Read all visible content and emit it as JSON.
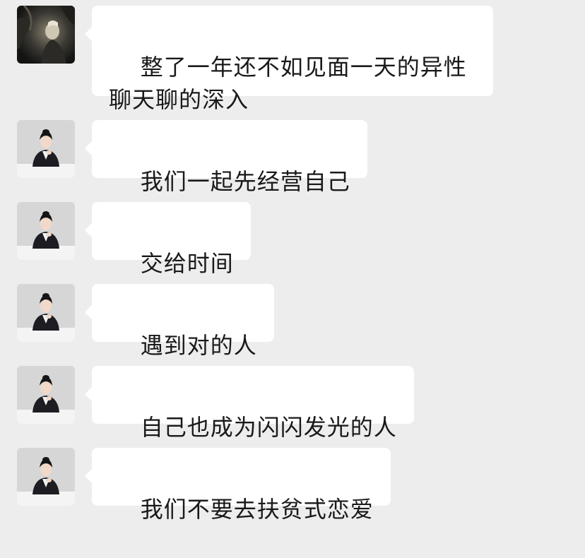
{
  "chat": {
    "background": "#ededed",
    "bubble_color": "#ffffff",
    "text_color": "#191919",
    "messages": [
      {
        "sender": "contact-dark-avatar",
        "text": "整了一年还不如见面一天的异性聊天聊的深入"
      },
      {
        "sender": "contact-woman-avatar",
        "text": "我们一起先经营自己"
      },
      {
        "sender": "contact-woman-avatar",
        "text": "交给时间"
      },
      {
        "sender": "contact-woman-avatar",
        "text": "遇到对的人"
      },
      {
        "sender": "contact-woman-avatar",
        "text": "自己也成为闪闪发光的人"
      },
      {
        "sender": "contact-woman-avatar",
        "text": "我们不要去扶贫式恋爱"
      }
    ]
  }
}
